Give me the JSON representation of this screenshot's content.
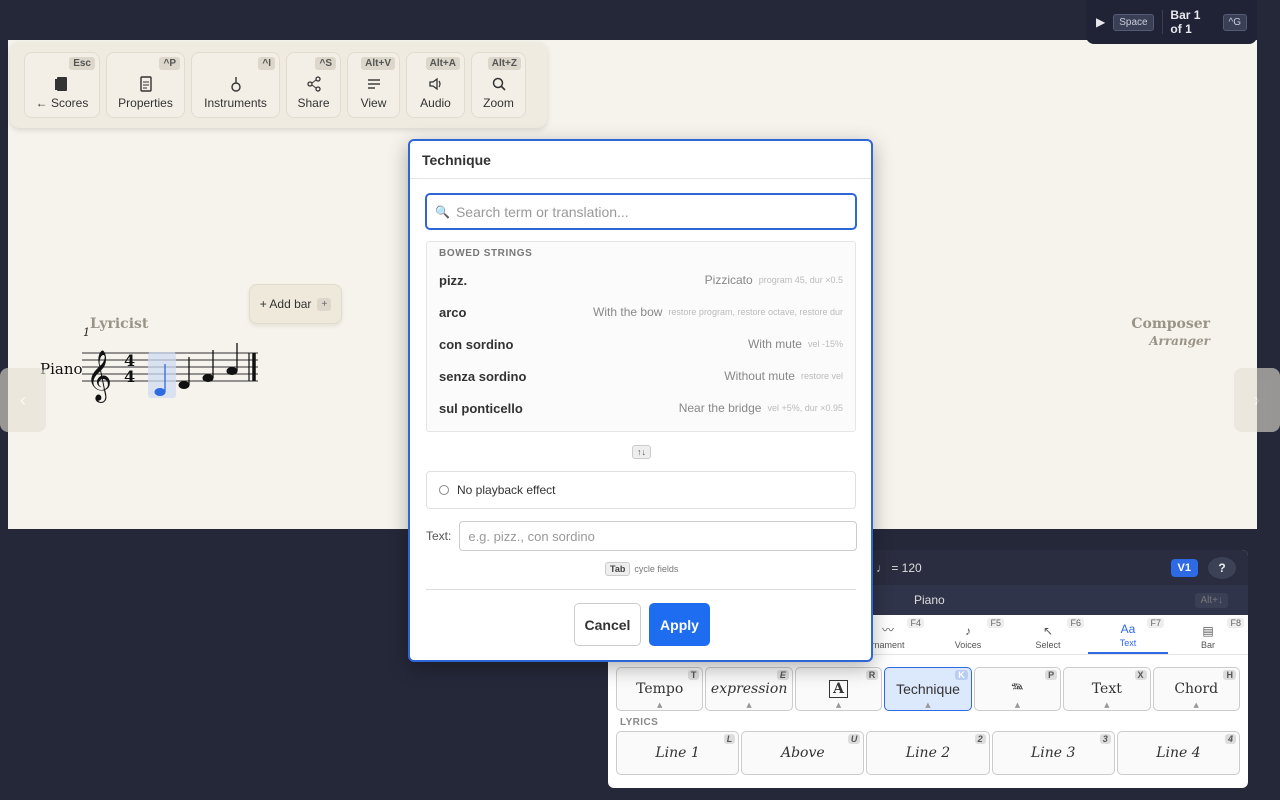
{
  "toolbar": [
    {
      "label": "← Scores",
      "key": "Esc",
      "icon": "book-icon"
    },
    {
      "label": "Properties",
      "key": "^P",
      "icon": "document-icon"
    },
    {
      "label": "Instruments",
      "key": "^I",
      "icon": "guitar-icon"
    },
    {
      "label": "Share",
      "key": "^S",
      "icon": "share-icon"
    },
    {
      "label": "View",
      "key": "Alt+V",
      "icon": "lines-icon"
    },
    {
      "label": "Audio",
      "key": "Alt+A",
      "icon": "speaker-icon"
    },
    {
      "label": "Zoom",
      "key": "Alt+Z",
      "icon": "search-icon"
    }
  ],
  "status": {
    "play_key": "Space",
    "bar": "Bar 1 of 1",
    "bar_key": "^G"
  },
  "score": {
    "lyricist": "Lyricist",
    "composer": "Composer",
    "arranger": "Arranger",
    "instrument": "Piano",
    "bar_number": "1",
    "add_bar": "+ Add bar",
    "add_bar_key": "+"
  },
  "dialog": {
    "title": "Technique",
    "search_placeholder": "Search term or translation...",
    "category": "BOWED STRINGS",
    "items": [
      {
        "term": "pizz.",
        "translation": "Pizzicato",
        "effect": "program 45, dur ×0.5"
      },
      {
        "term": "arco",
        "translation": "With the bow",
        "effect": "restore program, restore octave, restore dur"
      },
      {
        "term": "con sordino",
        "translation": "With mute",
        "effect": "vel -15%"
      },
      {
        "term": "senza sordino",
        "translation": "Without mute",
        "effect": "restore vel"
      },
      {
        "term": "sul ponticello",
        "translation": "Near the bridge",
        "effect": "vel +5%, dur ×0.95"
      }
    ],
    "sort_key": "↑↓",
    "no_playback": "No playback effect",
    "text_label": "Text:",
    "text_placeholder": "e.g. pizz., con sordino",
    "hint_key": "Tab",
    "hint_text": "cycle fields",
    "cancel": "Cancel",
    "apply": "Apply"
  },
  "panel": {
    "tempo": "♩ = 120",
    "voice": "V1",
    "help": "?",
    "instrument": "Piano",
    "instrument_key": "Alt+↓",
    "tabs": [
      {
        "label": "rnament",
        "key": "F4",
        "icon": "〰"
      },
      {
        "label": "Voices",
        "key": "F5",
        "icon": "♪"
      },
      {
        "label": "Select",
        "key": "F6",
        "icon": "↖"
      },
      {
        "label": "Text",
        "key": "F7",
        "icon": "Aa"
      },
      {
        "label": "Bar",
        "key": "F8",
        "icon": "▤"
      }
    ],
    "tools": [
      {
        "label": "Tempo",
        "key": "T"
      },
      {
        "label": "expression",
        "key": "E"
      },
      {
        "label": "A",
        "key": "R"
      },
      {
        "label": "Technique",
        "key": "K"
      },
      {
        "label": "𝆮",
        "key": "P"
      },
      {
        "label": "Text",
        "key": "X"
      },
      {
        "label": "Chord",
        "key": "H"
      }
    ],
    "lyrics_label": "LYRICS",
    "lyrics": [
      {
        "label": "Line 1",
        "key": "L"
      },
      {
        "label": "Above",
        "key": "U"
      },
      {
        "label": "Line 2",
        "key": "2"
      },
      {
        "label": "Line 3",
        "key": "3"
      },
      {
        "label": "Line 4",
        "key": "4"
      }
    ]
  },
  "colors": {
    "accent": "#2d6ae3",
    "canvas": "#f6f2ec",
    "background": "#252839"
  }
}
